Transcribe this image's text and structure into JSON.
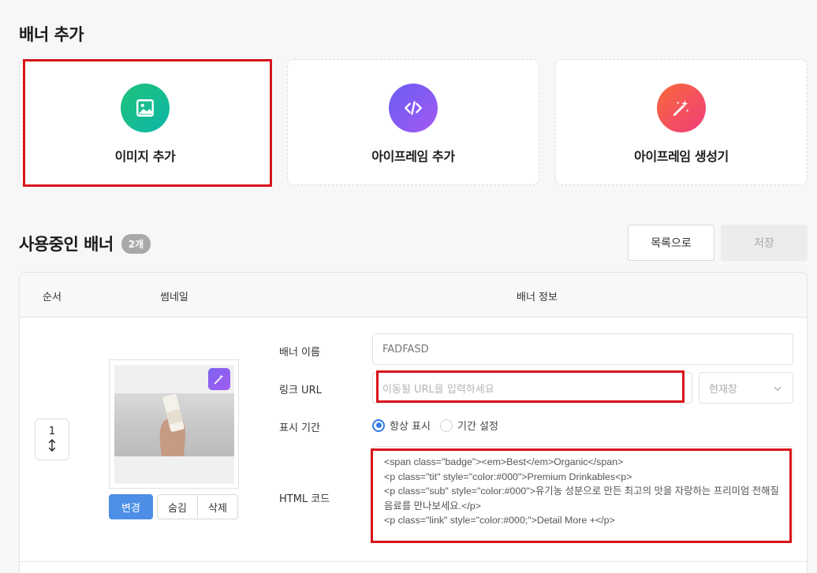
{
  "add_section": {
    "title": "배너 추가"
  },
  "cards": [
    {
      "label": "이미지 추가",
      "icon": "image-icon"
    },
    {
      "label": "아이프레임 추가",
      "icon": "code-icon"
    },
    {
      "label": "아이프레임 생성기",
      "icon": "magic-wand-icon"
    }
  ],
  "used_section": {
    "title": "사용중인 배너",
    "count": "2개"
  },
  "toolbar": {
    "list_label": "목록으로",
    "save_label": "저장"
  },
  "table": {
    "headers": {
      "order": "순서",
      "thumbnail": "썸네일",
      "info": "배너 정보"
    },
    "row": {
      "order": "1",
      "order_icon": "updown-arrow-icon",
      "buttons": {
        "change": "변경",
        "hide": "숨김",
        "delete": "삭제"
      },
      "labels": {
        "name": "배너 이름",
        "url": "링크 URL",
        "period": "표시 기간",
        "html": "HTML 코드"
      },
      "name_value": "FADFASD",
      "url_placeholder": "이동될 URL을 입력하세요",
      "target_value": "현재창",
      "period_options": [
        "항상 표시",
        "기간 설정"
      ],
      "period_selected": "항상 표시",
      "html_code": "<span class=\"badge\"><em>Best</em>Organic</span>\n<p class=\"tit\" style=\"color:#000\">Premium Drinkables<p>\n<p class=\"sub\" style=\"color:#000\">유기농 성분으로 만든 최고의 맛을 자랑하는 프리미엄 전해질 음료를 만나보세요.</p>\n<p class=\"link\" style=\"color:#000;\">Detail More +</p>"
    }
  },
  "colors": {
    "highlight": "#d9141b",
    "primary": "#4d8fe6",
    "card_green": "#1fc27a",
    "card_purple": "#8a5cf3",
    "card_orange": "#f5533f"
  }
}
